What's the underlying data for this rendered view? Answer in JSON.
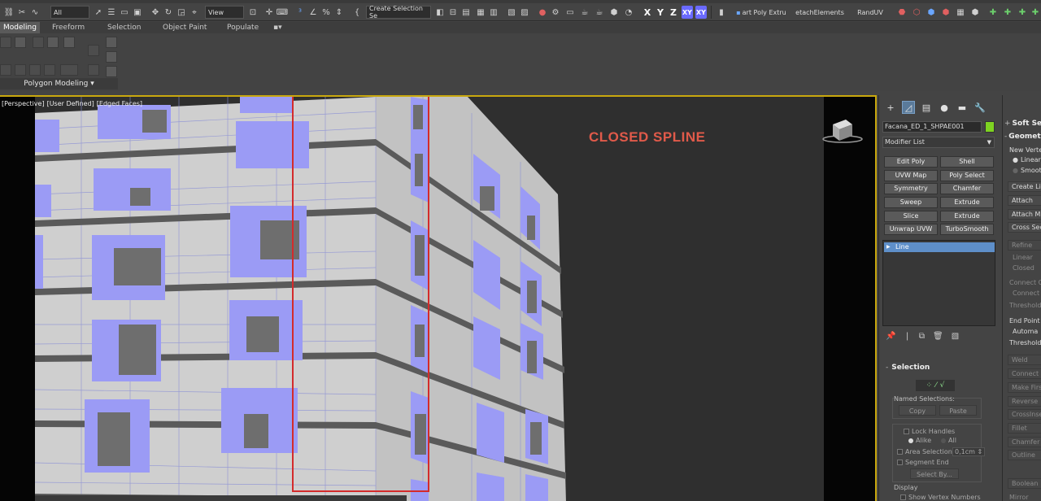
{
  "toolbar": {
    "selection_filter": "All",
    "reference_coord": "View",
    "named_selection": "Create Selection Se",
    "axis_x": "X",
    "axis_y": "Y",
    "axis_z": "Z",
    "axis_xy": "XY",
    "axis_xy2": "XY",
    "script_a": "art Poly Extru",
    "script_b": "etachElements",
    "script_c": "RandUV"
  },
  "ribbon": {
    "tabs": [
      "Modeling",
      "Freeform",
      "Selection",
      "Object Paint",
      "Populate"
    ],
    "panel_label": "Polygon Modeling"
  },
  "viewport": {
    "labels": [
      "[Perspective]",
      "[User Defined]",
      "[Edged Faces]"
    ],
    "annotation": "CLOSED SPLINE",
    "accent_color": "#c9a80e",
    "highlight_color": "#d42b2b",
    "annotation_color": "#e05a4a"
  },
  "command_panel": {
    "object_name": "Facana_ED_1_SHPAE001",
    "object_color": "#7ed321",
    "modifier_list": "Modifier List",
    "modifiers": [
      "Edit Poly",
      "Shell",
      "UVW Map",
      "Poly Select",
      "Symmetry",
      "Chamfer",
      "Sweep",
      "Extrude",
      "Slice",
      "Extrude",
      "Unwrap UVW",
      "TurboSmooth"
    ],
    "stack_item": "Line",
    "selection": {
      "title": "Selection",
      "named_selections": "Named Selections:",
      "copy": "Copy",
      "paste": "Paste",
      "lock_handles": "Lock Handles",
      "alike": "Alike",
      "all": "All",
      "area_selection": "Area Selection:",
      "area_value": "0,1cm",
      "segment_end": "Segment End",
      "select_by": "Select By...",
      "display": "Display",
      "show_vertex_numbers": "Show Vertex Numbers"
    }
  },
  "geometry_panel": {
    "soft_selection": "Soft Selection",
    "geometry": "Geometry",
    "new_vertex": "New Vertex",
    "linear": "Linear",
    "smooth": "Smooth",
    "create_line": "Create Line",
    "attach": "Attach",
    "attach_mult": "Attach Mult",
    "cross_section": "Cross Section",
    "refine": "Refine",
    "linear2": "Linear",
    "closed": "Closed",
    "connect_copy": "Connect Co",
    "connect": "Connect",
    "threshold": "Threshold",
    "end_point": "End Point A",
    "automatic": "Automa",
    "threshold2": "Threshold",
    "weld": "Weld",
    "connect2": "Connect",
    "make_first": "Make First",
    "reverse": "Reverse",
    "cross_insert": "CrossInser",
    "fillet": "Fillet",
    "chamfer": "Chamfer",
    "outline": "Outline",
    "boolean": "Boolean",
    "mirror": "Mirror"
  }
}
